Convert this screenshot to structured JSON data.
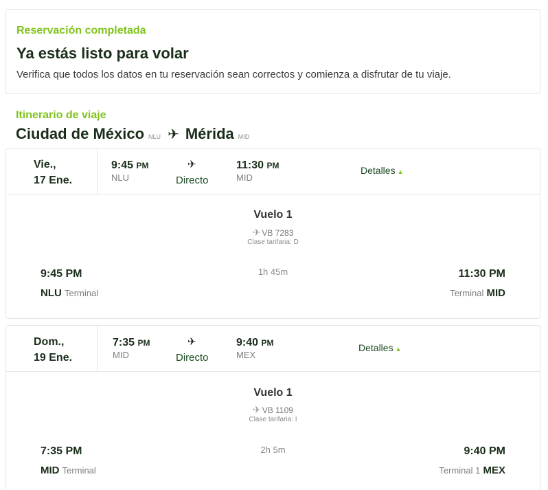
{
  "confirmation": {
    "kicker": "Reservación completada",
    "title": "Ya estás listo para volar",
    "description": "Verifica que todos los datos en tu reservación sean correctos y comienza a disfrutar de tu viaje."
  },
  "itinerary": {
    "kicker": "Itinerario de viaje",
    "origin_city": "Ciudad de México",
    "origin_code": "NLU",
    "destination_city": "Mérida",
    "destination_code": "MID"
  },
  "segments": [
    {
      "day": "Vie.,",
      "date": "17 Ene.",
      "depart_time": "9:45",
      "depart_ampm": "PM",
      "depart_code": "NLU",
      "stops": "Directo",
      "arrive_time": "11:30",
      "arrive_ampm": "PM",
      "arrive_code": "MID",
      "details_label": "Detalles",
      "flight_title": "Vuelo 1",
      "flight_number": "VB 7283",
      "fare_class": "Clase tarifaria: D",
      "duration": "1h 45m",
      "origin_time_full": "9:45 PM",
      "destination_time_full": "11:30 PM",
      "origin_terminal": "Terminal",
      "destination_terminal": "Terminal"
    },
    {
      "day": "Dom.,",
      "date": "19 Ene.",
      "depart_time": "7:35",
      "depart_ampm": "PM",
      "depart_code": "MID",
      "stops": "Directo",
      "arrive_time": "9:40",
      "arrive_ampm": "PM",
      "arrive_code": "MEX",
      "details_label": "Detalles",
      "flight_title": "Vuelo 1",
      "flight_number": "VB 1109",
      "fare_class": "Clase tarifaria: I",
      "duration": "2h 5m",
      "origin_time_full": "7:35 PM",
      "destination_time_full": "9:40 PM",
      "origin_terminal": "Terminal",
      "destination_terminal": "Terminal 1"
    }
  ],
  "colors": {
    "accent": "#7fc31c",
    "text_dark": "#1a2e1a",
    "border": "#e4e6e4"
  },
  "icons": {
    "route_plane": "airplane-icon",
    "details_caret": "caret-up-icon"
  }
}
